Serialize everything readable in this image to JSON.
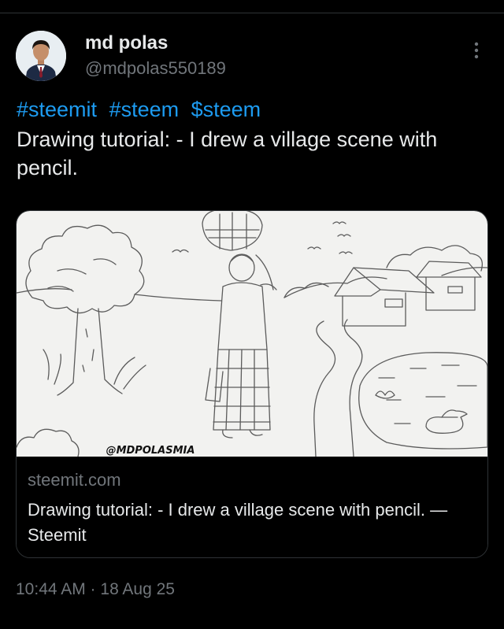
{
  "author": {
    "name": "md polas",
    "handle": "@mdpolas550189"
  },
  "icons": {
    "more": "more-vertical-icon",
    "avatar": "profile-photo"
  },
  "colors": {
    "background": "#000000",
    "text_primary": "#e7e9ea",
    "text_secondary": "#71767b",
    "link": "#1d9bf0",
    "border": "#2f3336"
  },
  "tweet": {
    "hashtags": [
      "#steemit",
      "#steem",
      "$steem"
    ],
    "text": "Drawing tutorial: - I drew a village scene with pencil."
  },
  "card": {
    "image_watermark": "@MDPOLASMIA",
    "domain": "steemit.com",
    "title": "Drawing tutorial: - I drew a village scene with pencil. — Steemit"
  },
  "timestamp": "10:44 AM · 18 Aug 25"
}
